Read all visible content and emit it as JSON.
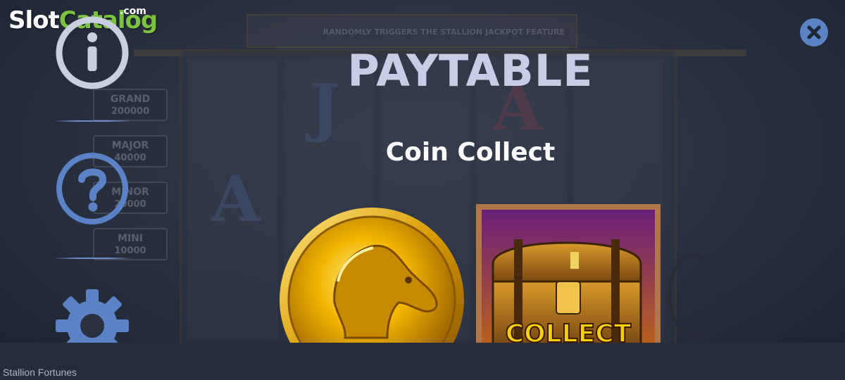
{
  "logo": {
    "slot": "Slot",
    "catalog": "Catalog",
    "dotcom": ".com"
  },
  "background": {
    "banner_text": "RANDOMLY TRIGGERS THE STALLION JACKPOT FEATURE",
    "jackpots": [
      {
        "name": "GRAND",
        "amount": "200000"
      },
      {
        "name": "MAJOR",
        "amount": "40000"
      },
      {
        "name": "MINOR",
        "amount": "20000"
      },
      {
        "name": "MINI",
        "amount": "10000"
      }
    ]
  },
  "menu": {
    "items": [
      {
        "icon": "info-icon"
      },
      {
        "icon": "help-icon"
      },
      {
        "icon": "gear-icon"
      }
    ]
  },
  "close": {
    "icon": "close-icon"
  },
  "paytable": {
    "title": "PAYTABLE",
    "section": "Coin Collect",
    "symbols": [
      {
        "name": "horse-coin",
        "icon": "horse-coin-icon"
      },
      {
        "name": "treasure-chest-collect",
        "icon": "treasure-chest-icon",
        "label": "COLLECT"
      }
    ]
  },
  "colors": {
    "title": "#c8cde4",
    "accent_blue": "#5b82c4",
    "logo_green": "#7cc240",
    "coin_gold": "#f2b600"
  },
  "footer": {
    "game_name": "Stallion Fortunes"
  }
}
